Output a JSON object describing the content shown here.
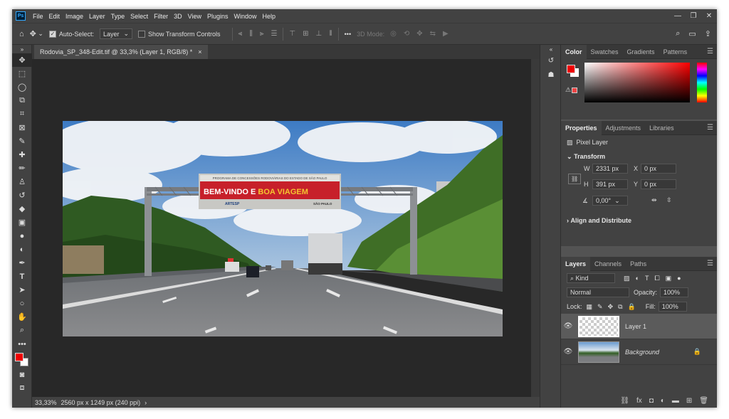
{
  "app": {
    "logo": "Ps"
  },
  "menu": {
    "items": [
      "File",
      "Edit",
      "Image",
      "Layer",
      "Type",
      "Select",
      "Filter",
      "3D",
      "View",
      "Plugins",
      "Window",
      "Help"
    ]
  },
  "window_controls": [
    "—",
    "❐",
    "✕"
  ],
  "options": {
    "auto_select_label": "Auto-Select:",
    "auto_select_value": "Layer",
    "transform_controls_label": "Show Transform Controls",
    "mode_3d_label": "3D Mode:"
  },
  "document": {
    "tab_title": "Rodovia_SP_348-Edit.tif @ 33,3% (Layer 1, RGB/8) *",
    "close_glyph": "×",
    "zoom": "33,33%",
    "doc_info": "2560 px x 1249 px (240 ppi)"
  },
  "billboard": {
    "top_text": "PROGRAMA DE CONCESSÕES RODOVIÁRIAS DO ESTADO DE SÃO PAULO",
    "main_white": "BEM-VINDO E ",
    "main_yellow": "BOA VIAGEM",
    "artesp": "ARTESP",
    "sp": "SÃO PAULO"
  },
  "color_panel": {
    "tabs": [
      "Color",
      "Swatches",
      "Gradients",
      "Patterns"
    ],
    "fg": "#e00000",
    "bg": "#ffffff"
  },
  "properties": {
    "tabs": [
      "Properties",
      "Adjustments",
      "Libraries"
    ],
    "layer_type": "Pixel Layer",
    "transform_label": "Transform",
    "w_label": "W",
    "w": "2331 px",
    "h_label": "H",
    "h": "391 px",
    "x_label": "X",
    "x": "0 px",
    "y_label": "Y",
    "y": "0 px",
    "angle": "0,00°",
    "align_label": "Align and Distribute"
  },
  "layers_panel": {
    "tabs": [
      "Layers",
      "Channels",
      "Paths"
    ],
    "filter": "Kind",
    "blend": "Normal",
    "opacity_label": "Opacity:",
    "opacity": "100%",
    "lock_label": "Lock:",
    "fill_label": "Fill:",
    "fill": "100%",
    "layers": [
      {
        "name": "Layer 1",
        "selected": true
      },
      {
        "name": "Background",
        "selected": false
      }
    ]
  }
}
